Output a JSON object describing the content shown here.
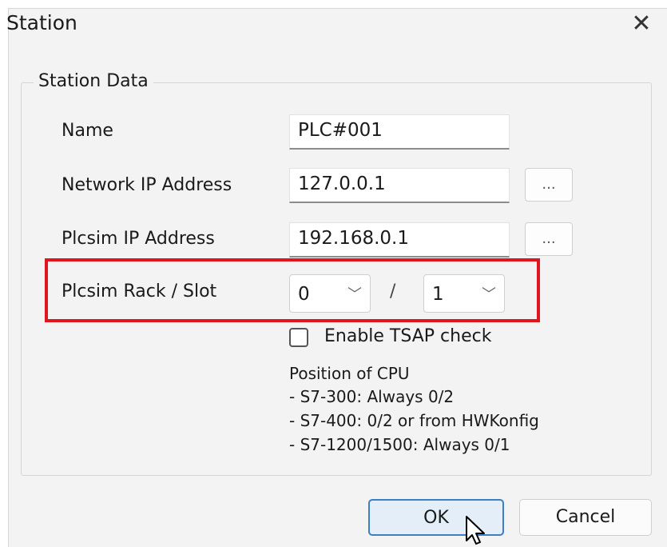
{
  "window": {
    "title": "Station",
    "close_glyph": "✕"
  },
  "group": {
    "label": "Station Data"
  },
  "fields": {
    "name": {
      "label": "Name",
      "value": "PLC#001"
    },
    "network_ip": {
      "label": "Network IP Address",
      "value": "127.0.0.1",
      "browse": "..."
    },
    "plcsim_ip": {
      "label": "Plcsim IP Address",
      "value": "192.168.0.1",
      "browse": "..."
    },
    "rack_slot": {
      "label": "Plcsim Rack / Slot",
      "rack": "0",
      "separator": "/",
      "slot": "1",
      "chevron": "﹀"
    }
  },
  "tsap": {
    "label": "Enable TSAP check",
    "checked": false
  },
  "info_lines": [
    "Position of CPU",
    "- S7-300: Always 0/2",
    "- S7-400: 0/2 or from HWKonfig",
    "- S7-1200/1500: Always 0/1"
  ],
  "buttons": {
    "ok": "OK",
    "cancel": "Cancel"
  },
  "colors": {
    "highlight": "#e0161e",
    "ok_border": "#3c7fc5"
  }
}
